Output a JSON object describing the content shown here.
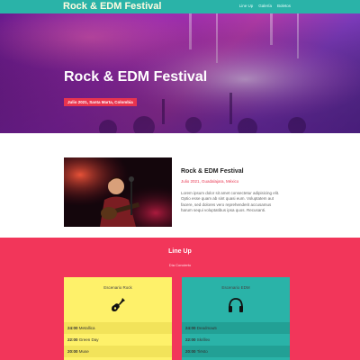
{
  "header": {
    "brand": "Rock & EDM Festival",
    "nav": [
      "Line Up",
      "Galería",
      "Boletos"
    ]
  },
  "hero": {
    "title": "Rock & EDM Festival",
    "badge": "Julio 2021, Santa Marta, Colombia"
  },
  "about": {
    "title": "Rock & EDM Festival",
    "date": "Julio 2021, Guadalajara, México",
    "text": "Lorem ipsum dolor sit amet consectetur adipisicing elit. Optio esse quam ab sint quasi eum. Voluptatem aut facere, sed dolores vero reprehenderit accusamus harum sequi voluptatibus ipsa quos. Recusanti."
  },
  "lineup": {
    "title": "Line Up",
    "date": "Día Concierto",
    "stages": [
      {
        "name": "Escenario Rock",
        "icon": "guitar-icon",
        "slots": [
          {
            "time": "24:00",
            "artist": "Metallica"
          },
          {
            "time": "22:00",
            "artist": "Green Day"
          },
          {
            "time": "20:00",
            "artist": "Muse"
          }
        ]
      },
      {
        "name": "Escenario EDM",
        "icon": "headphones-icon",
        "slots": [
          {
            "time": "24:00",
            "artist": "Deadmau5"
          },
          {
            "time": "22:00",
            "artist": "Skrillex"
          },
          {
            "time": "20:00",
            "artist": "Tiësto"
          }
        ]
      }
    ]
  },
  "colors": {
    "teal": "#2ab3a8",
    "accent_red": "#e8344f",
    "lineup_bg": "#f2365a",
    "rock_card": "#fef16a"
  }
}
